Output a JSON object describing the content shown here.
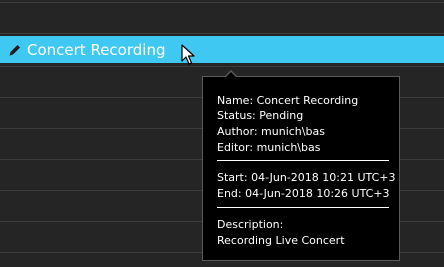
{
  "recording_row": {
    "title": "Concert Recording",
    "icon": "pencil-icon"
  },
  "tooltip": {
    "name": "Name: Concert Recording",
    "status": "Status: Pending",
    "author": "Author: munich\\bas",
    "editor": "Editor: munich\\bas",
    "start": "Start: 04-Jun-2018 10:21 UTC+3",
    "end": "End: 04-Jun-2018 10:26 UTC+3",
    "description_label": "Description:",
    "description_value": "Recording Live Concert"
  },
  "colors": {
    "selection": "#3fc8f2",
    "background": "#252525",
    "tooltip_background": "#000000"
  }
}
